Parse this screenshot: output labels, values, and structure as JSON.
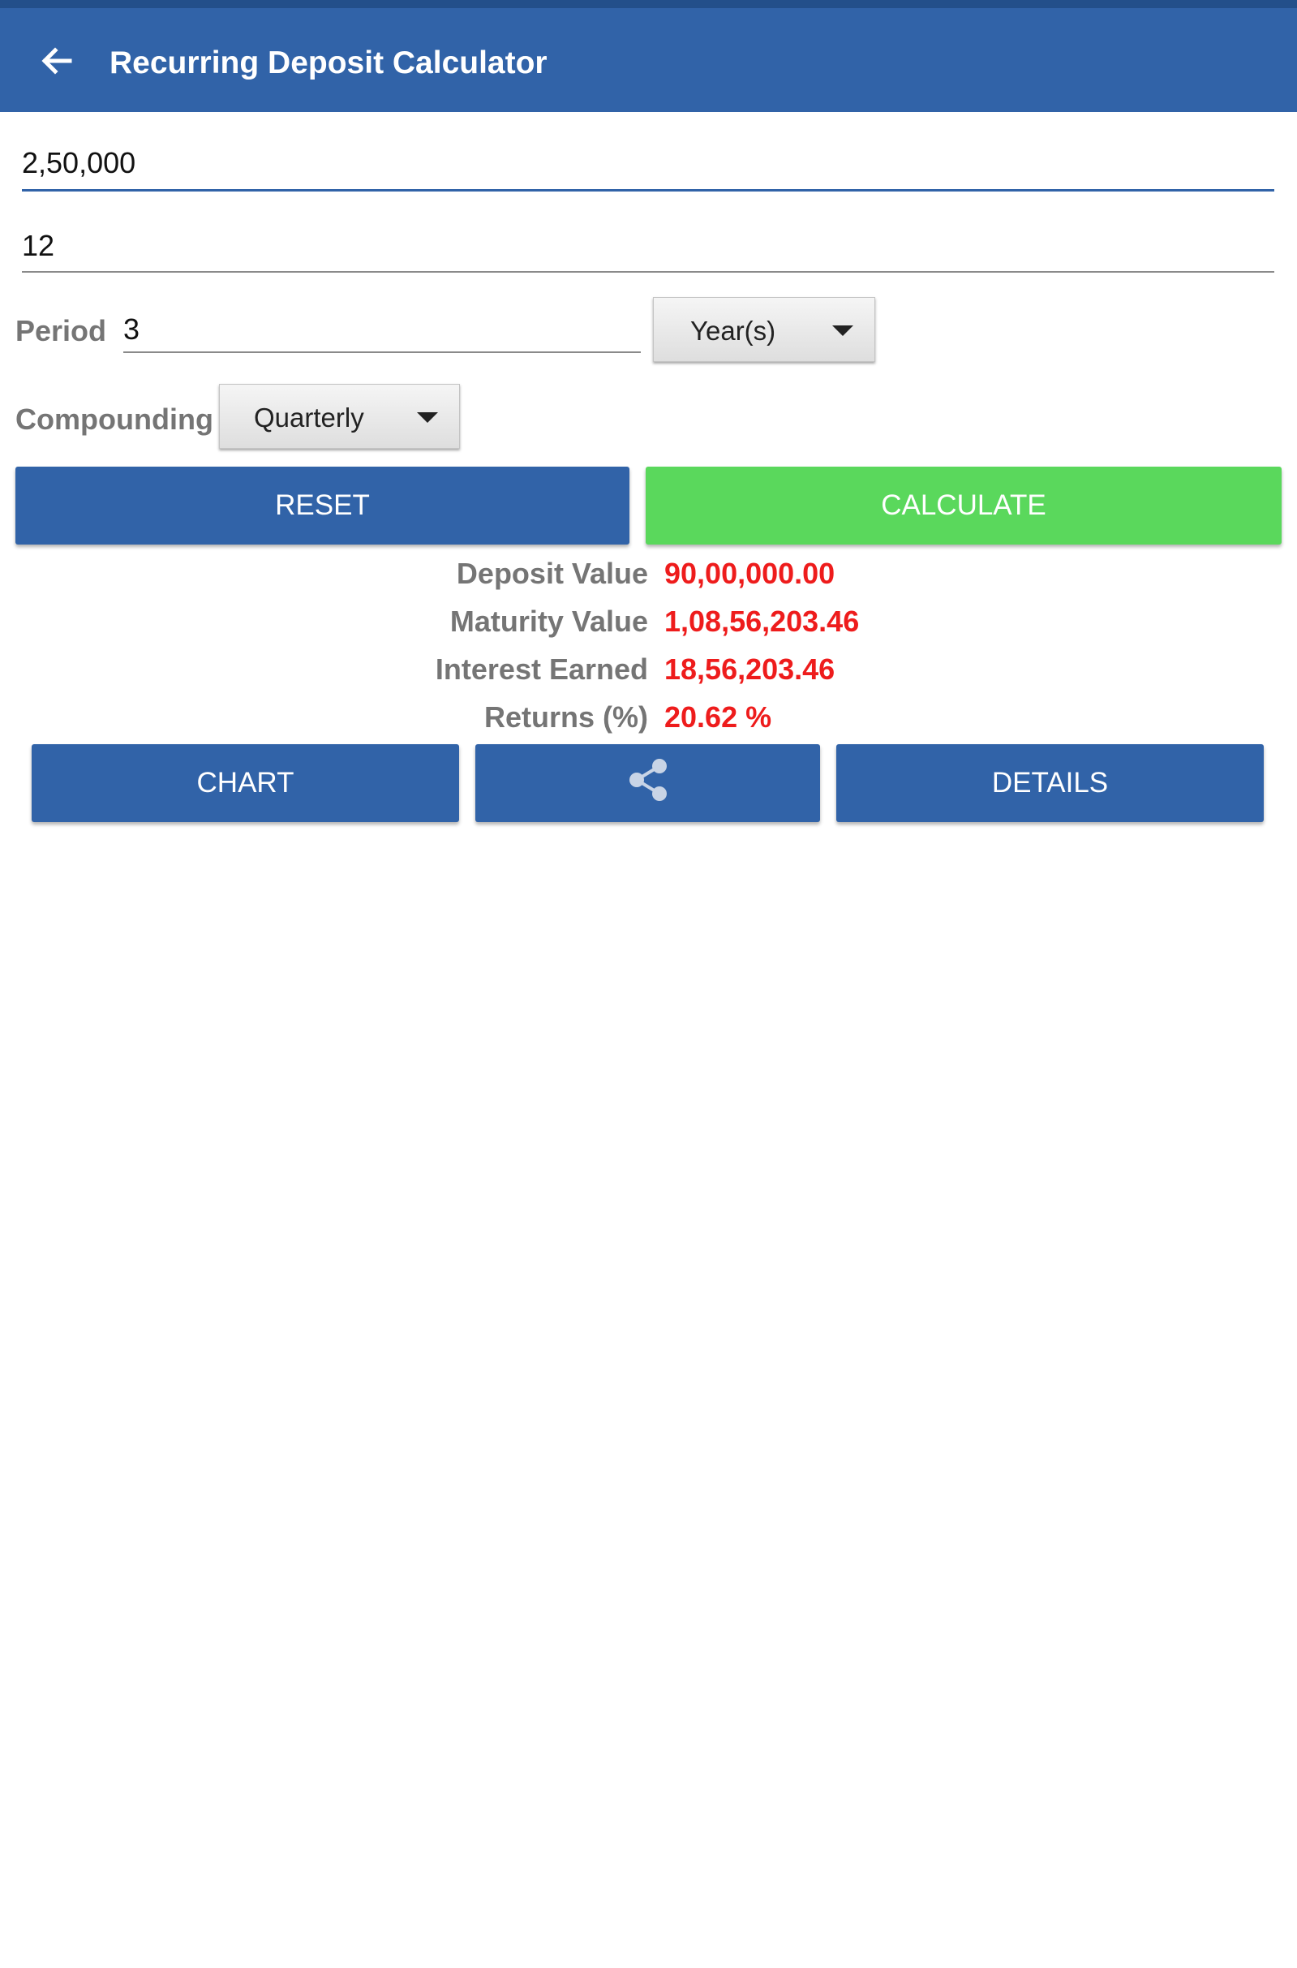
{
  "app": {
    "title": "Recurring Deposit Calculator"
  },
  "inputs": {
    "amount": "2,50,000",
    "rate": "12",
    "period_label": "Period",
    "period_value": "3",
    "period_unit": "Year(s)",
    "compounding_label": "Compounding",
    "compounding_value": "Quarterly"
  },
  "buttons": {
    "reset": "RESET",
    "calculate": "CALCULATE",
    "chart": "CHART",
    "details": "DETAILS"
  },
  "results": {
    "deposit_label": "Deposit Value",
    "deposit_value": "90,00,000.00",
    "maturity_label": "Maturity Value",
    "maturity_value": "1,08,56,203.46",
    "interest_label": "Interest Earned",
    "interest_value": "18,56,203.46",
    "returns_label": "Returns (%)",
    "returns_value": "20.62 %"
  },
  "colors": {
    "primary": "#3163a8",
    "accent_green": "#5ad85c",
    "result_red": "#ee1c1c",
    "label_gray": "#757575"
  },
  "icons": {
    "back": "arrow-left-icon",
    "share": "share-icon",
    "dropdown": "caret-down-icon"
  }
}
